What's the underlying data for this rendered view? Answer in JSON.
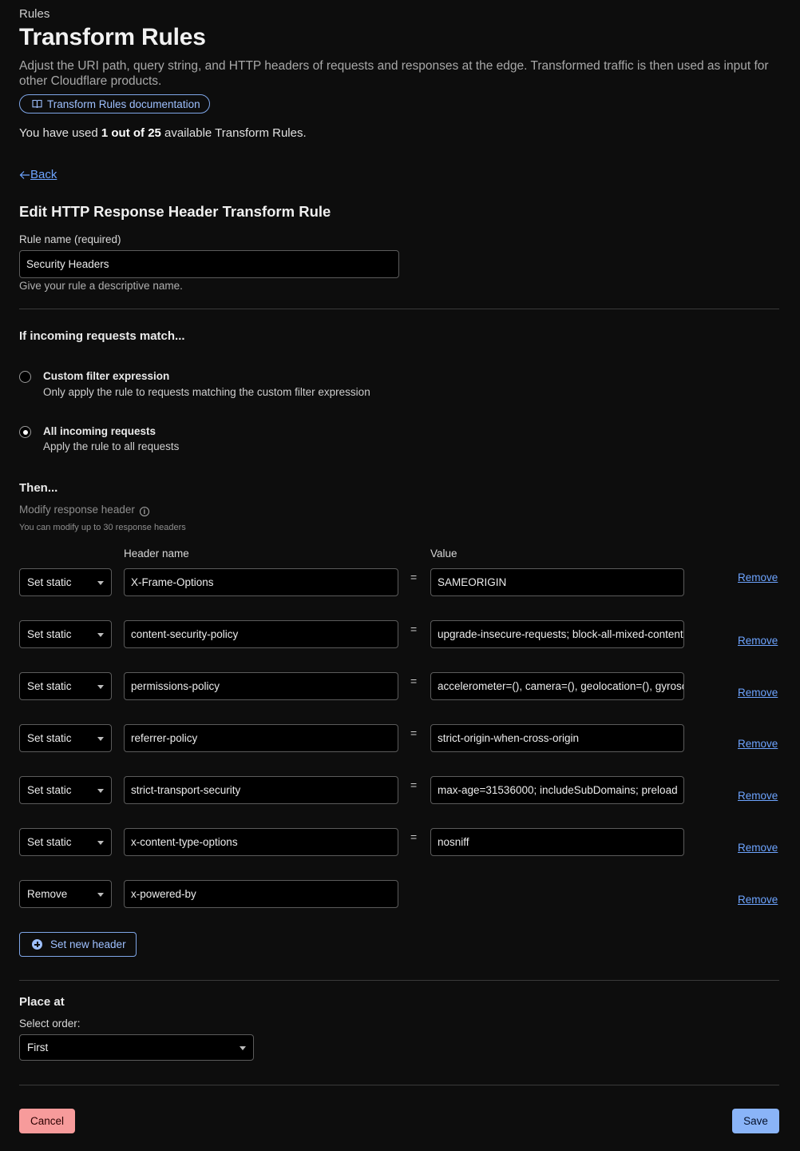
{
  "header": {
    "breadcrumb": "Rules",
    "title": "Transform Rules",
    "description": "Adjust the URI path, query string, and HTTP headers of requests and responses at the edge. Transformed traffic is then used as input for other Cloudflare products.",
    "doc_link": "Transform Rules documentation",
    "usage_prefix": "You have used ",
    "usage_count": "1 out of 25",
    "usage_suffix": " available Transform Rules."
  },
  "back_label": "Back",
  "form": {
    "heading": "Edit HTTP Response Header Transform Rule",
    "rule_name_label": "Rule name (required)",
    "rule_name_value": "Security Headers",
    "rule_name_help": "Give your rule a descriptive name."
  },
  "match": {
    "heading": "If incoming requests match...",
    "options": [
      {
        "title": "Custom filter expression",
        "subtitle": "Only apply the rule to requests matching the custom filter expression",
        "selected": false
      },
      {
        "title": "All incoming requests",
        "subtitle": "Apply the rule to all requests",
        "selected": true
      }
    ]
  },
  "then": {
    "heading": "Then...",
    "modify_label": "Modify response header",
    "modify_help": "You can modify up to 30 response headers",
    "col_header_name": "Header name",
    "col_value": "Value",
    "equals": "=",
    "remove_label": "Remove",
    "rows": [
      {
        "operation": "Set static",
        "name": "X-Frame-Options",
        "value": "SAMEORIGIN"
      },
      {
        "operation": "Set static",
        "name": "content-security-policy",
        "value": "upgrade-insecure-requests; block-all-mixed-content"
      },
      {
        "operation": "Set static",
        "name": "permissions-policy",
        "value": "accelerometer=(), camera=(), geolocation=(), gyroscope=()"
      },
      {
        "operation": "Set static",
        "name": "referrer-policy",
        "value": "strict-origin-when-cross-origin"
      },
      {
        "operation": "Set static",
        "name": "strict-transport-security",
        "value": "max-age=31536000; includeSubDomains; preload"
      },
      {
        "operation": "Set static",
        "name": "x-content-type-options",
        "value": "nosniff"
      },
      {
        "operation": "Remove",
        "name": "x-powered-by",
        "value": ""
      }
    ],
    "new_header_label": "Set new header"
  },
  "place": {
    "heading": "Place at",
    "order_label": "Select order:",
    "order_value": "First"
  },
  "actions": {
    "cancel": "Cancel",
    "save": "Save"
  },
  "colors": {
    "accent": "#6da4ff",
    "save_bg": "#8ab4f8",
    "cancel_bg": "#f79b9b",
    "background": "#0d0d0d"
  }
}
